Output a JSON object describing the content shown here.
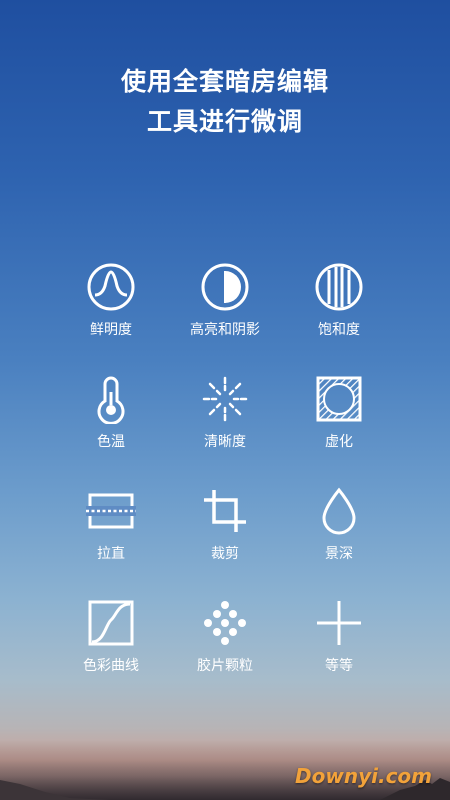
{
  "headline": {
    "line1": "使用全套暗房编辑",
    "line2": "工具进行微调"
  },
  "tools": [
    {
      "icon": "brilliance-icon",
      "label": "鲜明度"
    },
    {
      "icon": "highlights-shadows-icon",
      "label": "高亮和阴影"
    },
    {
      "icon": "saturation-icon",
      "label": "饱和度"
    },
    {
      "icon": "temperature-icon",
      "label": "色温"
    },
    {
      "icon": "sharpen-icon",
      "label": "清晰度"
    },
    {
      "icon": "vignette-icon",
      "label": "虚化"
    },
    {
      "icon": "straighten-icon",
      "label": "拉直"
    },
    {
      "icon": "crop-icon",
      "label": "裁剪"
    },
    {
      "icon": "depth-of-field-icon",
      "label": "景深"
    },
    {
      "icon": "curves-icon",
      "label": "色彩曲线"
    },
    {
      "icon": "film-grain-icon",
      "label": "胶片颗粒"
    },
    {
      "icon": "plus-icon",
      "label": "等等"
    }
  ],
  "watermark": "Downyi.com"
}
